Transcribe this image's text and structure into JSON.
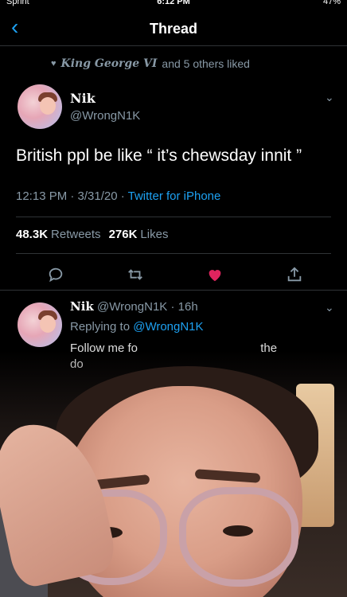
{
  "status_bar": {
    "carrier": "Sprint",
    "time": "6:12 PM",
    "battery": "47%"
  },
  "nav": {
    "title": "Thread"
  },
  "social_context": {
    "liker": "King George VI",
    "rest": "and 5 others liked"
  },
  "tweet": {
    "name": "Nik",
    "handle": "@WrongN1K",
    "text": "British ppl be like “ it’s chewsday innit ”",
    "time": "12:13 PM · 3/31/20 · ",
    "source": "Twitter for iPhone",
    "retweets": "48.3K",
    "retweets_label": "Retweets",
    "likes": "276K",
    "likes_label": "Likes"
  },
  "reply": {
    "name": "Nik",
    "handle_time": "@WrongN1K · 16h",
    "replying_prefix": "Replying to",
    "replying_handle": "@WrongN1K",
    "text_start": "Follow me fo",
    "text_end": "the",
    "text_line2": "do"
  },
  "colors": {
    "accent": "#1da1f2",
    "like": "#e0245e",
    "muted": "#8899a6",
    "background": "#000000"
  },
  "icons": [
    "back-chevron-icon",
    "heart-icon",
    "reply-icon",
    "retweet-icon",
    "like-icon",
    "share-icon",
    "chevron-down-icon"
  ]
}
